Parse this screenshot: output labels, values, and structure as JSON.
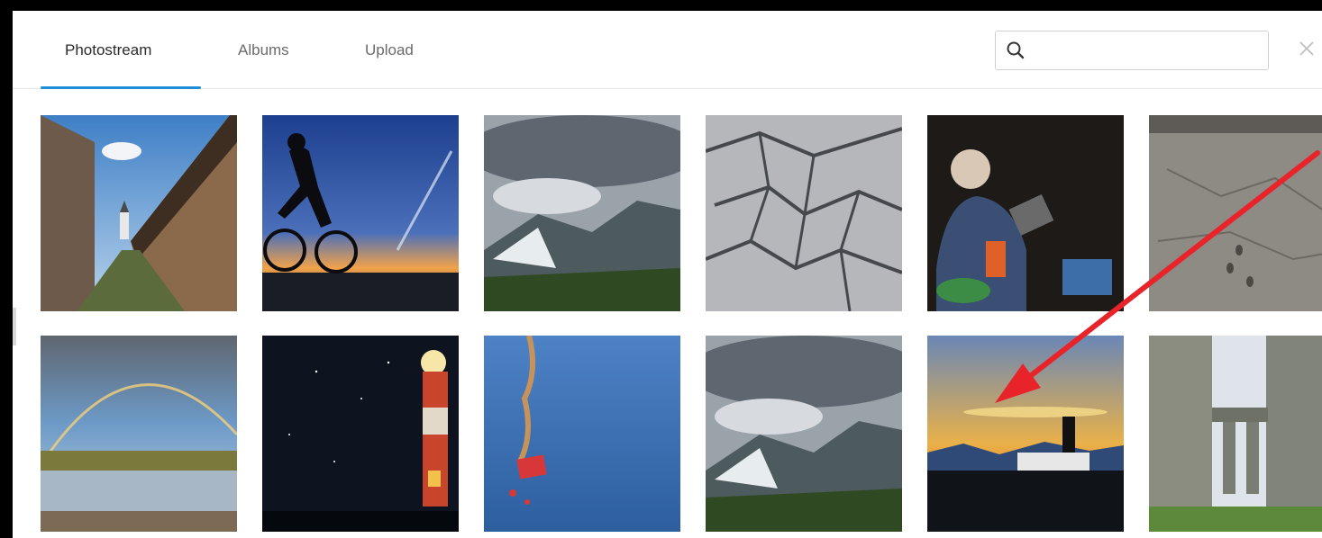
{
  "tabs": [
    {
      "label": "Photostream",
      "active": true
    },
    {
      "label": "Albums",
      "active": false
    },
    {
      "label": "Upload",
      "active": false
    }
  ],
  "search": {
    "value": "",
    "placeholder": ""
  },
  "icons": {
    "search": "search-icon",
    "close": "close-icon"
  },
  "colors": {
    "accent": "#1c8fd8",
    "annotation": "#e8232a"
  },
  "photos": [
    {
      "subject": "wooden building alley"
    },
    {
      "subject": "cyclist silhouette at dusk"
    },
    {
      "subject": "glacier valley"
    },
    {
      "subject": "cracked rock texture"
    },
    {
      "subject": "man pouring from kettle"
    },
    {
      "subject": "sand with footprints"
    },
    {
      "subject": "rainbow over lake"
    },
    {
      "subject": "lighthouse at night"
    },
    {
      "subject": "red object in water"
    },
    {
      "subject": "glacier valley"
    },
    {
      "subject": "lighthouse at sunset"
    },
    {
      "subject": "stonehenge"
    }
  ]
}
